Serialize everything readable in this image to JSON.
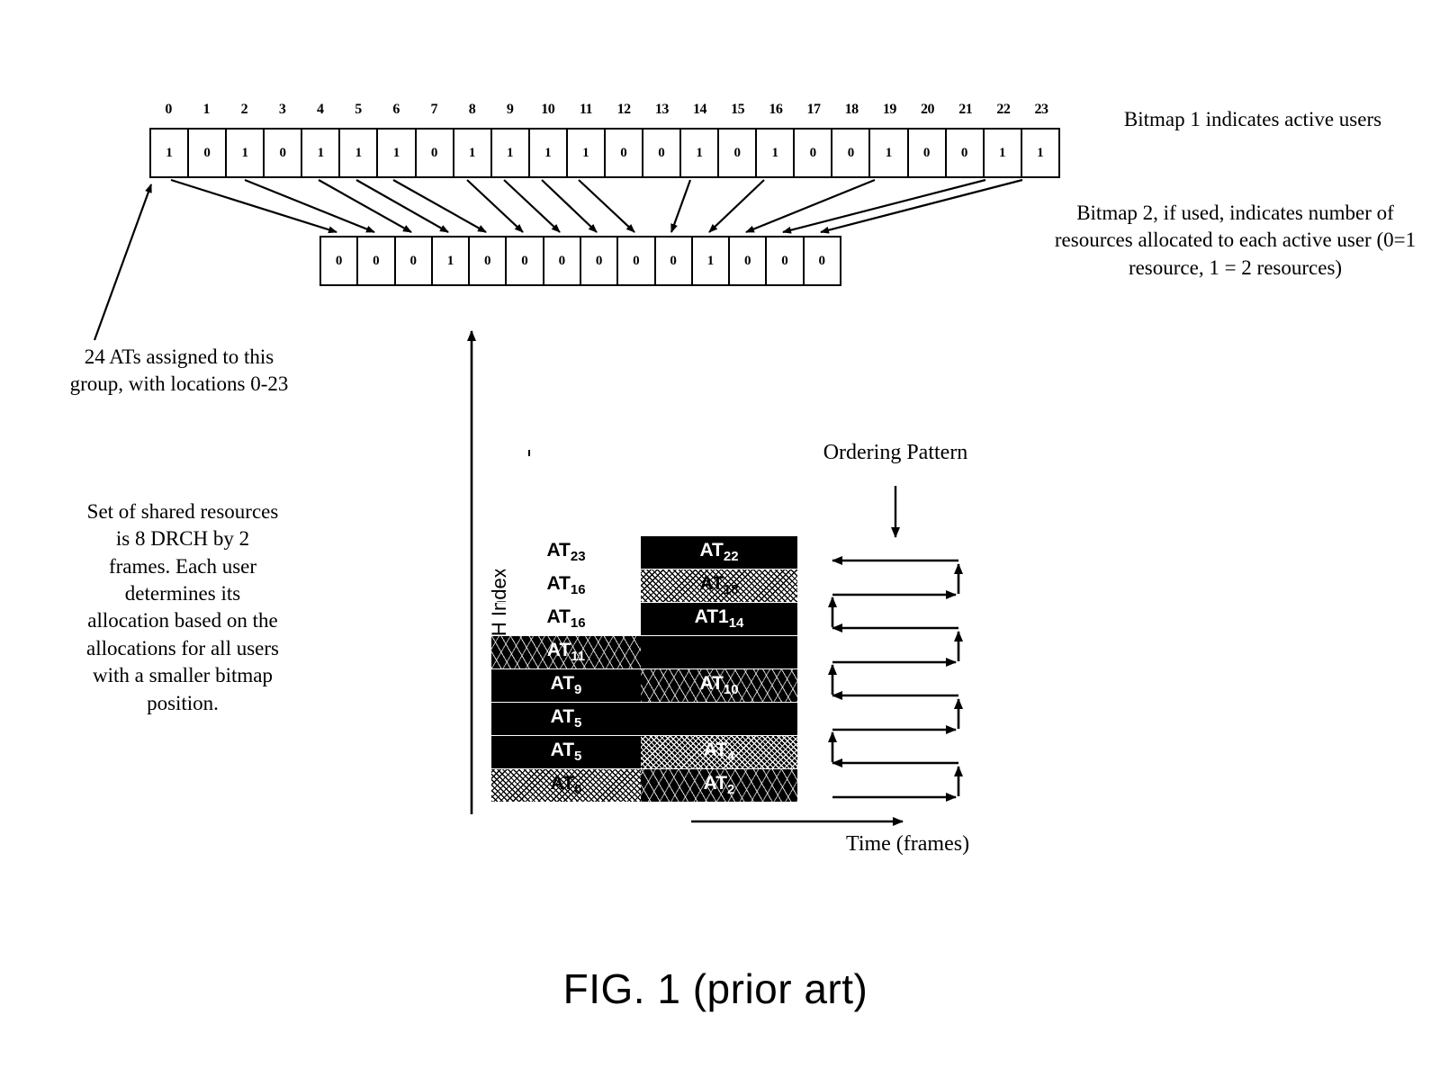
{
  "figure": {
    "caption": "FIG. 1 (prior art)"
  },
  "bitmap1": {
    "indices": [
      "0",
      "1",
      "2",
      "3",
      "4",
      "5",
      "6",
      "7",
      "8",
      "9",
      "10",
      "11",
      "12",
      "13",
      "14",
      "15",
      "16",
      "17",
      "18",
      "19",
      "20",
      "21",
      "22",
      "23"
    ],
    "values": [
      "1",
      "0",
      "1",
      "0",
      "1",
      "1",
      "1",
      "0",
      "1",
      "1",
      "1",
      "1",
      "0",
      "0",
      "1",
      "0",
      "1",
      "0",
      "0",
      "1",
      "0",
      "0",
      "1",
      "1"
    ],
    "note": "Bitmap 1 indicates active users"
  },
  "bitmap2": {
    "values": [
      "0",
      "0",
      "0",
      "1",
      "0",
      "0",
      "0",
      "0",
      "0",
      "0",
      "1",
      "0",
      "0",
      "0"
    ],
    "note": "Bitmap 2, if used, indicates number of resources allocated to each active user (0=1 resource, 1 = 2 resources)"
  },
  "annotations": {
    "ats_assigned": "24 ATs assigned to this group, with locations 0-23",
    "shared_resources": "Set of shared resources is 8 DRCH by 2 frames.  Each user determines its allocation based on the allocations for all users with a smaller bitmap position."
  },
  "chart": {
    "y_axis_label": "DRCH Index",
    "x_axis_label": "Time (frames)",
    "ordering_label": "Ordering Pattern",
    "rows": [
      [
        {
          "label": "AT",
          "sub": "23",
          "fill": "none"
        },
        {
          "label": "AT",
          "sub": "22",
          "fill": "black"
        }
      ],
      [
        {
          "label": "AT",
          "sub": "16",
          "fill": "none"
        },
        {
          "label": "AT",
          "sub": "18",
          "fill": "noise-light"
        }
      ],
      [
        {
          "label": "AT",
          "sub": "16",
          "fill": "none"
        },
        {
          "label": "AT1",
          "sub": "14",
          "fill": "black"
        }
      ],
      [
        {
          "label": "AT",
          "sub": "11",
          "fill": "speckle-dark"
        },
        {
          "label": "",
          "sub": "",
          "fill": "empty"
        }
      ],
      [
        {
          "label": "AT",
          "sub": "9",
          "fill": "black"
        },
        {
          "label": "AT",
          "sub": "10",
          "fill": "speckle-dark"
        }
      ],
      [
        {
          "label": "AT",
          "sub": "5",
          "fill": "black"
        },
        {
          "label": "",
          "sub": "",
          "fill": "empty"
        }
      ],
      [
        {
          "label": "AT",
          "sub": "5",
          "fill": "black"
        },
        {
          "label": "AT",
          "sub": "4",
          "fill": "noise-dark"
        }
      ],
      [
        {
          "label": "AT",
          "sub": "0",
          "fill": "noise-light"
        },
        {
          "label": "AT",
          "sub": "2",
          "fill": "speckle-dark"
        }
      ]
    ]
  },
  "colors": {
    "ink": "#000000",
    "paper": "#ffffff"
  }
}
